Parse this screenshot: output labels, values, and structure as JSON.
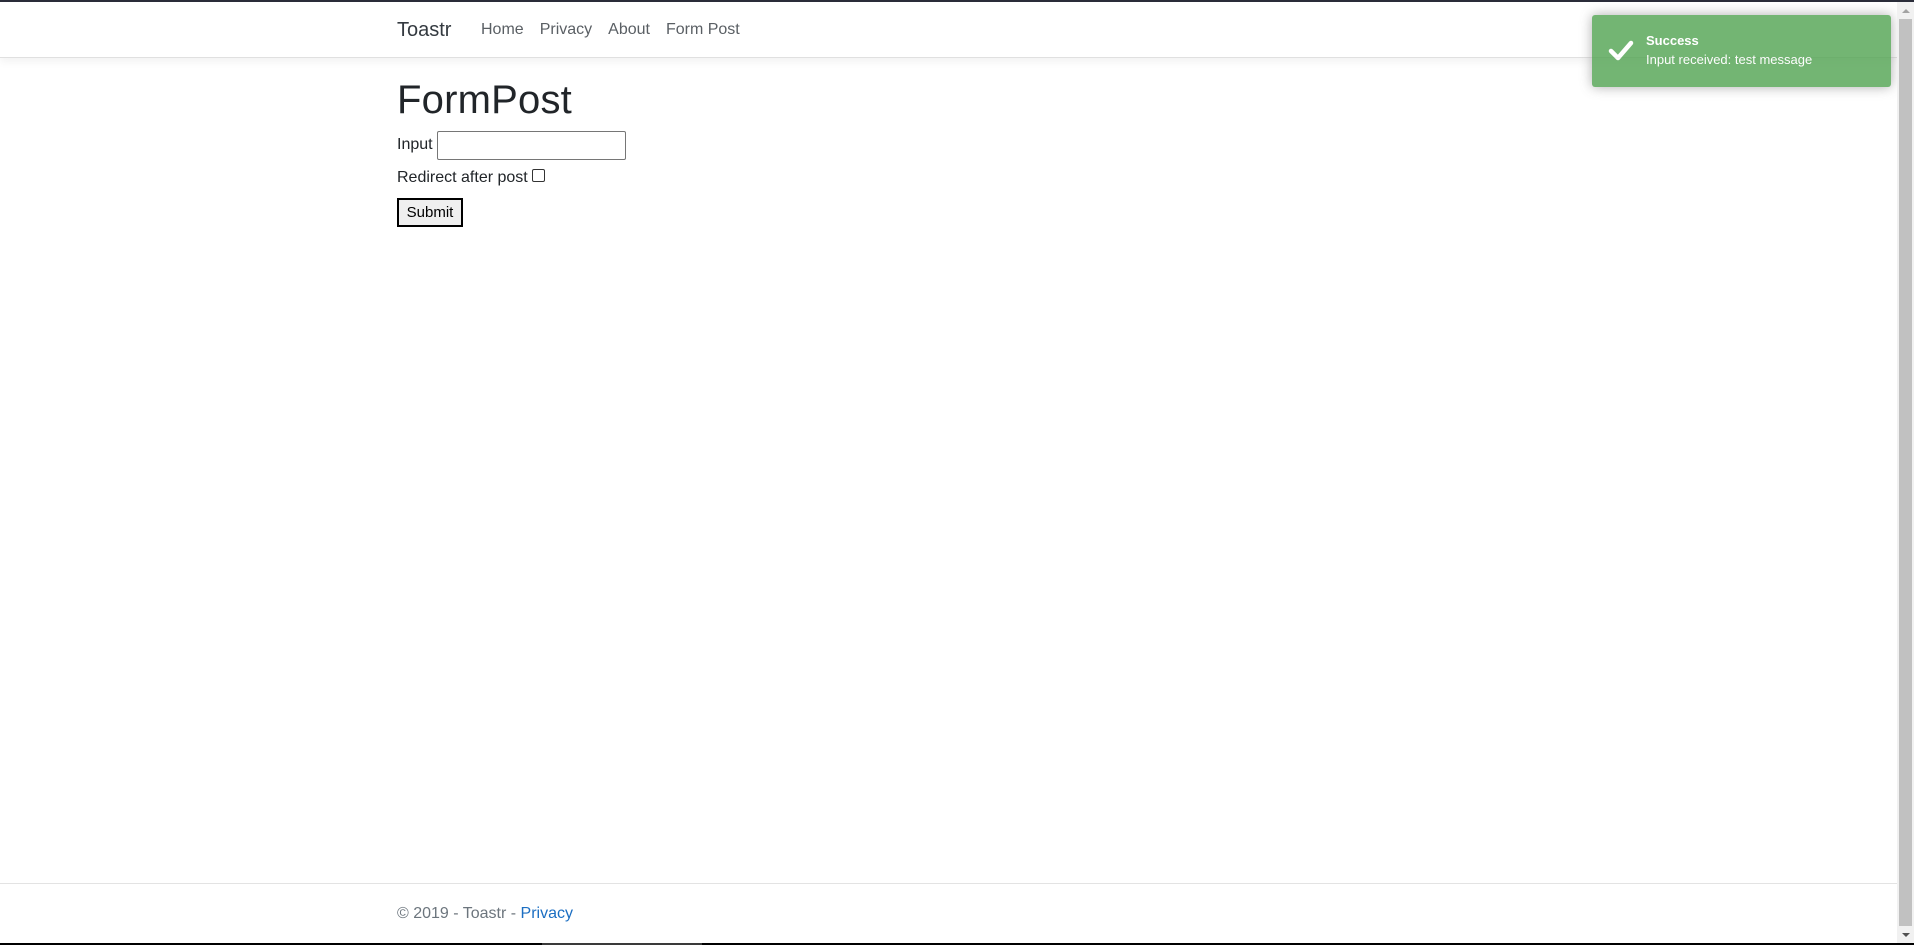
{
  "navbar": {
    "brand": "Toastr",
    "links": [
      {
        "label": "Home"
      },
      {
        "label": "Privacy"
      },
      {
        "label": "About"
      },
      {
        "label": "Form Post"
      }
    ]
  },
  "page": {
    "title": "FormPost",
    "input_label": "Input",
    "input_value": "",
    "input_placeholder": "",
    "checkbox_label": "Redirect after post",
    "checkbox_checked": false,
    "submit_label": "Submit"
  },
  "footer": {
    "text": "© 2019 - Toastr - ",
    "link_label": "Privacy",
    "link_color": "#1b6ec2"
  },
  "toast": {
    "type": "success",
    "icon": "checkmark-icon",
    "title": "Success",
    "message": "Input received: test message",
    "color": "#51a351"
  }
}
